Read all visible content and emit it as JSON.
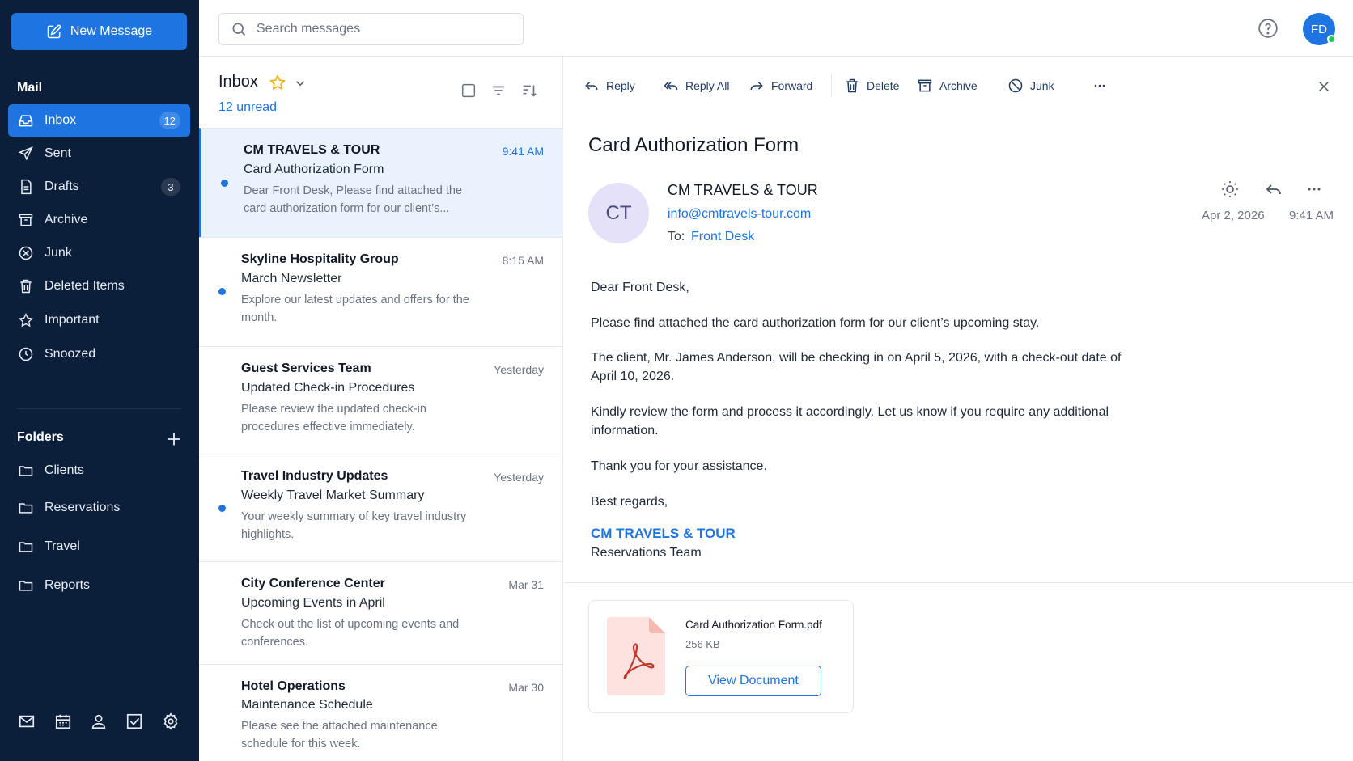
{
  "sidebar": {
    "new_message_label": "New Message",
    "mail_section_title": "Mail",
    "items": [
      {
        "label": "Inbox",
        "badge": "12"
      },
      {
        "label": "Sent"
      },
      {
        "label": "Drafts",
        "badge": "3"
      },
      {
        "label": "Archive"
      },
      {
        "label": "Junk"
      },
      {
        "label": "Deleted Items"
      },
      {
        "label": "Important"
      },
      {
        "label": "Snoozed"
      }
    ],
    "folders_section_title": "Folders",
    "folders": [
      {
        "label": "Clients"
      },
      {
        "label": "Reservations"
      },
      {
        "label": "Travel"
      },
      {
        "label": "Reports"
      }
    ],
    "bottom_icons": [
      "mail-icon",
      "calendar-icon",
      "person-icon",
      "tasks-icon",
      "settings-icon"
    ]
  },
  "topbar": {
    "search_placeholder": "Search messages",
    "avatar_initials": "FD"
  },
  "list": {
    "title": "Inbox",
    "unread_label": "12 unread",
    "messages": [
      {
        "sender": "CM TRAVELS & TOUR",
        "time": "9:41 AM",
        "subject": "Card Authorization Form",
        "preview": "Dear Front Desk, Please find attached the card authorization form for our client’s...",
        "unread": true,
        "selected": true
      },
      {
        "sender": "Skyline Hospitality Group",
        "time": "8:15 AM",
        "subject": "March Newsletter",
        "preview": "Explore our latest updates and offers for the month.",
        "unread": true,
        "selected": false
      },
      {
        "sender": "Guest Services Team",
        "time": "Yesterday",
        "subject": "Updated Check-in Procedures",
        "preview": "Please review the updated check-in procedures effective immediately.",
        "unread": false,
        "selected": false
      },
      {
        "sender": "Travel Industry Updates",
        "time": "Yesterday",
        "subject": "Weekly Travel Market Summary",
        "preview": "Your weekly summary of key travel industry highlights.",
        "unread": true,
        "selected": false
      },
      {
        "sender": "City Conference Center",
        "time": "Mar 31",
        "subject": "Upcoming Events in April",
        "preview": "Check out the list of upcoming events and conferences.",
        "unread": false,
        "selected": false
      },
      {
        "sender": "Hotel Operations",
        "time": "Mar 30",
        "subject": "Maintenance Schedule",
        "preview": "Please see the attached maintenance schedule for this week.",
        "unread": false,
        "selected": false
      }
    ]
  },
  "reader": {
    "toolbar": {
      "reply": "Reply",
      "reply_all": "Reply All",
      "forward": "Forward",
      "delete": "Delete",
      "archive": "Archive",
      "junk": "Junk"
    },
    "subject": "Card Authorization Form",
    "sender_initials": "CT",
    "sender_name": "CM TRAVELS & TOUR",
    "sender_email": "info@cmtravels-tour.com",
    "to_label": "To:",
    "to_name": "Front Desk",
    "date": "Apr 2, 2026",
    "time": "9:41 AM",
    "body": {
      "greeting": "Dear Front Desk,",
      "p1": "Please find attached the card authorization form for our client’s upcoming stay.",
      "p2": "The client, Mr. James Anderson, will be checking in on April 5, 2026, with a check-out date of April 10, 2026.",
      "p3": "Kindly review the form and process it accordingly. Let us know if you require any additional information.",
      "p4": "Thank you for your assistance.",
      "closing": "Best regards,",
      "sig_name": "CM TRAVELS & TOUR",
      "sig_team": "Reservations Team"
    },
    "attachment": {
      "name": "Card Authorization Form.pdf",
      "size": "256 KB",
      "button": "View Document"
    }
  },
  "colors": {
    "accent": "#1e74e0",
    "sidebar_bg": "#0c1f3a",
    "selected_row": "#eaf2fd",
    "online": "#22c55e"
  }
}
